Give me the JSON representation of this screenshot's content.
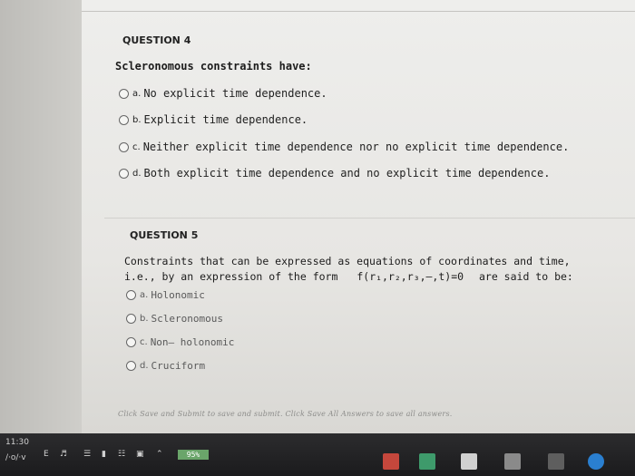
{
  "q4": {
    "title": "QUESTION 4",
    "prompt": "Scleronomous constraints have:",
    "options": [
      {
        "letter": "a.",
        "text": "No explicit time dependence."
      },
      {
        "letter": "b.",
        "text": "Explicit time dependence."
      },
      {
        "letter": "c.",
        "text": "Neither explicit time dependence nor no explicit time dependence."
      },
      {
        "letter": "d.",
        "text": "Both explicit time dependence and no explicit time dependence."
      }
    ]
  },
  "q5": {
    "title": "QUESTION 5",
    "prompt_line1": "Constraints that can be expressed as equations of coordinates and time,",
    "prompt_line2a": "i.e., by an expression of the form",
    "prompt_formula": "f(r₁,r₂,r₃,–,t)=0",
    "prompt_line2b": "are said to be:",
    "options": [
      {
        "letter": "a.",
        "text": "Holonomic"
      },
      {
        "letter": "b.",
        "text": "Scleronomous"
      },
      {
        "letter": "c.",
        "text": "Non– holonomic"
      },
      {
        "letter": "d.",
        "text": "Cruciform"
      }
    ]
  },
  "footer": {
    "note": "Click Save and Submit to save and submit. Click Save All Answers to save all answers."
  },
  "taskbar": {
    "time": "11:30",
    "date": "/·o/·v",
    "battery": "95%"
  }
}
